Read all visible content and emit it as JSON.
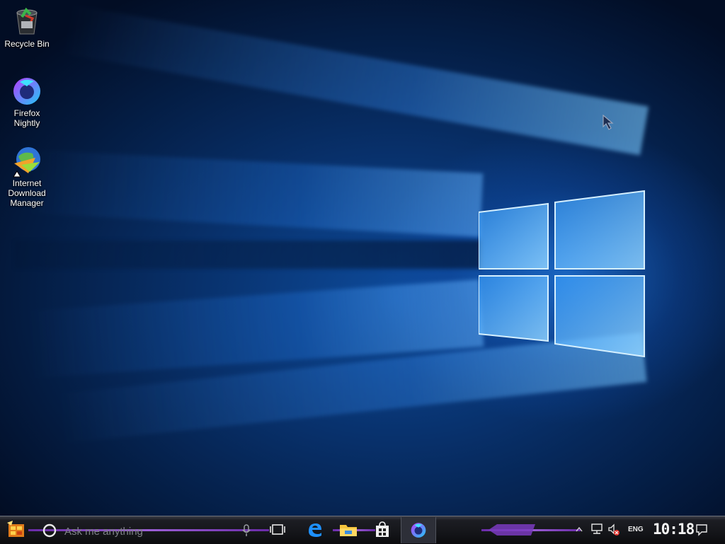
{
  "desktop": {
    "icons": [
      {
        "label": "Recycle Bin",
        "icon": "recycle-bin-icon"
      },
      {
        "label": "Firefox Nightly",
        "icon": "firefox-nightly-icon"
      },
      {
        "label": "Internet Download Manager",
        "icon": "internet-download-manager-icon"
      }
    ]
  },
  "taskbar": {
    "search_placeholder": "Ask me anything",
    "language": "ENG",
    "clock": "10:18",
    "pinned": [
      "task-view-icon",
      "edge-icon",
      "file-explorer-icon",
      "store-icon",
      "firefox-nightly-icon"
    ],
    "tray": [
      "show-hidden-icons-chevron",
      "network-icon",
      "volume-muted-icon",
      "notification-center-icon"
    ]
  },
  "colors": {
    "accent": "#9c5fd6",
    "wallpaper_glow": "#2a8cff"
  }
}
